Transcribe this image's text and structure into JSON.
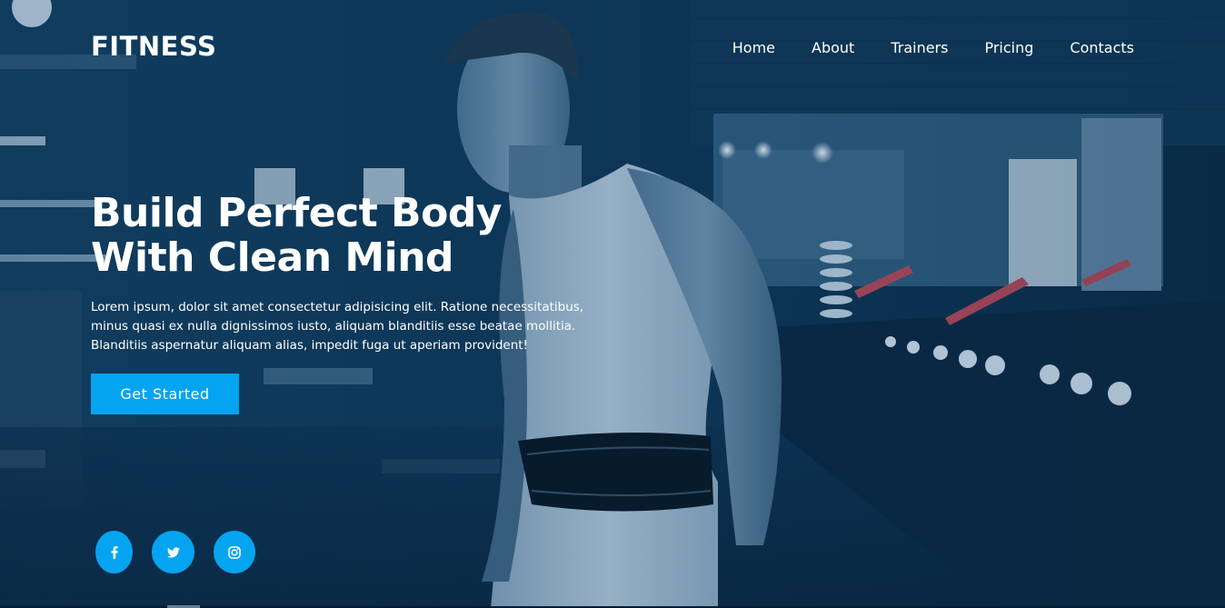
{
  "brand": {
    "logo": "FITNESS"
  },
  "nav": {
    "items": [
      "Home",
      "About",
      "Trainers",
      "Pricing",
      "Contacts"
    ]
  },
  "hero": {
    "headline": [
      "Build Perfect Body",
      "With Clean Mind"
    ],
    "description": [
      "Lorem ipsum, dolor sit amet consectetur adipisicing elit. Ratione necessitatibus,",
      "minus quasi ex nulla dignissimos iusto, aliquam blanditiis esse beatae mollitia.",
      "Blanditiis aspernatur aliquam alias, impedit fuga ut aperiam provident!"
    ],
    "cta_label": "Get Started"
  },
  "social": {
    "icons": [
      "facebook-icon",
      "twitter-icon",
      "instagram-icon"
    ]
  },
  "colors": {
    "accent": "#05a4f0",
    "overlay": "#0b3050",
    "text": "#ffffff"
  }
}
